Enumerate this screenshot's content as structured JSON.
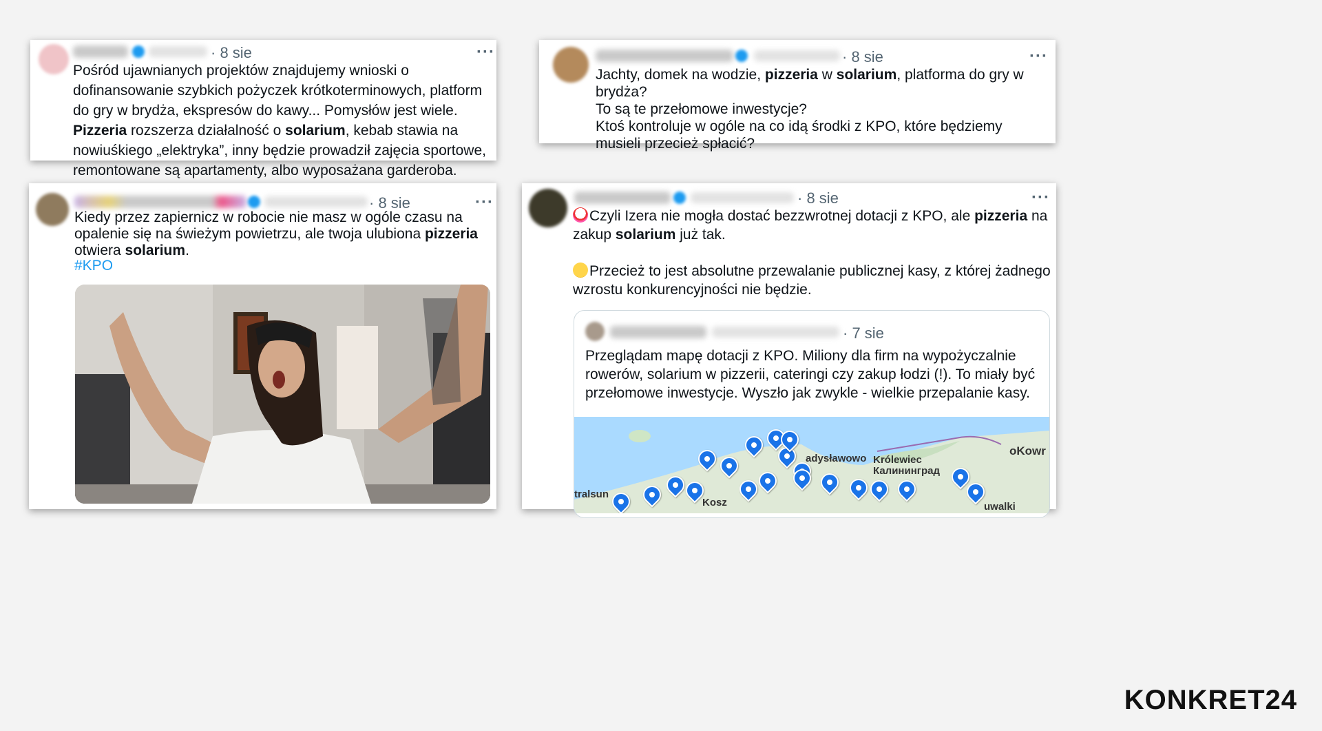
{
  "tweets": [
    {
      "date": "· 8 sie",
      "more": "···",
      "text_html": "Pośród ujawnianych projektów znajdujemy wnioski o dofinansowanie szybkich pożyczek krótkoterminowych, platform do gry w brydża, ekspresów do kawy... Pomysłów jest wiele. <b>Pizzeria</b> rozszerza działalność o <b>solarium</b>, kebab stawia na nowiuśkiego „elektryka”, inny będzie prowadził zajęcia sportowe, remontowane są apartamenty, albo wyposażana garderoba."
    },
    {
      "date": "· 8 sie",
      "more": "···",
      "text_html": "Jachty, domek na wodzie, <b>pizzeria</b> w <b>solarium</b>, platforma do gry w brydża?<br>To są te przełomowe inwestycje?<br>Ktoś kontroluje w ogóle na co idą środki z KPO, które będziemy musieli przecież spłacić?"
    },
    {
      "date": "· 8 sie",
      "more": "···",
      "text_html": "Kiedy przez zapiernicz w robocie nie masz w ogóle czasu na opalenie się na świeżym powietrzu, ale twoja ulubiona <b>pizzeria</b> otwiera <b>solarium</b>.",
      "hashtag": "#KPO"
    },
    {
      "date": "· 8 sie",
      "more": "···",
      "line1_html": "Czyli Izera nie mogła dostać bezzwrotnej dotacji z KPO, ale <b>pizzeria</b> na zakup <b>solarium</b> już tak.",
      "line2_html": "Przecież to jest absolutne przewalanie publicznej kasy, z której żadnego wzrostu konkurencyjności nie będzie.",
      "emoji1": "clown-face",
      "emoji2": "face-with-rolling-eyes",
      "quote": {
        "date": "· 7 sie",
        "text": "Przeglądam mapę dotacji z KPO. Miliony dla firm na wypożyczalnie rowerów, solarium w pizzerii, cateringi czy zakup łodzi (!). To miały być przełomowe inwestycje. Wyszło jak zwykle - wielkie przepalanie kasy."
      },
      "map": {
        "labels": [
          "adysławowo",
          "Królewiec",
          "Калининград",
          "oKowr",
          "tralsun",
          "Kosz",
          "uwalki"
        ]
      }
    }
  ],
  "logo": "KONKRET24",
  "colors": {
    "accent": "#1d9bf0",
    "text": "#0f1419",
    "muted": "#536471"
  }
}
